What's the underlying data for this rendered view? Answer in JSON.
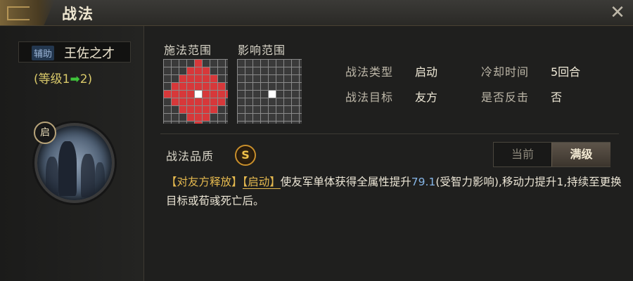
{
  "window": {
    "title": "战法"
  },
  "skill": {
    "tag": "辅助",
    "name": "王佐之才",
    "level_prefix": "(等级1",
    "level_arrow": "➡",
    "level_suffix": "2)",
    "start_badge": "启"
  },
  "range": {
    "cast_label": "施法范围",
    "effect_label": "影响范围"
  },
  "info": {
    "type_label": "战法类型",
    "type_value": "启动",
    "cooldown_label": "冷却时间",
    "cooldown_value": "5回合",
    "target_label": "战法目标",
    "target_value": "友方",
    "counter_label": "是否反击",
    "counter_value": "否"
  },
  "quality": {
    "label": "战法品质",
    "grade": "S"
  },
  "toggle": {
    "current": "当前",
    "max": "满级"
  },
  "description": {
    "tag1": "【对友方释放】",
    "tag2": "【启动】",
    "text1": "使友军单体获得全属性提升",
    "value": "79.1",
    "text2": "(受智力影响),移动力提升1,持续至更换目标或荀彧死亡后。"
  },
  "colors": {
    "accent_gold": "#e5b94f",
    "level_color": "#d9c96a",
    "arrow_green": "#3fc43a",
    "range_red": "#d7383a",
    "value_blue": "#86b5e6"
  },
  "icons": {
    "close": "close-icon",
    "start": "start-badge",
    "quality": "s-quality-badge"
  }
}
